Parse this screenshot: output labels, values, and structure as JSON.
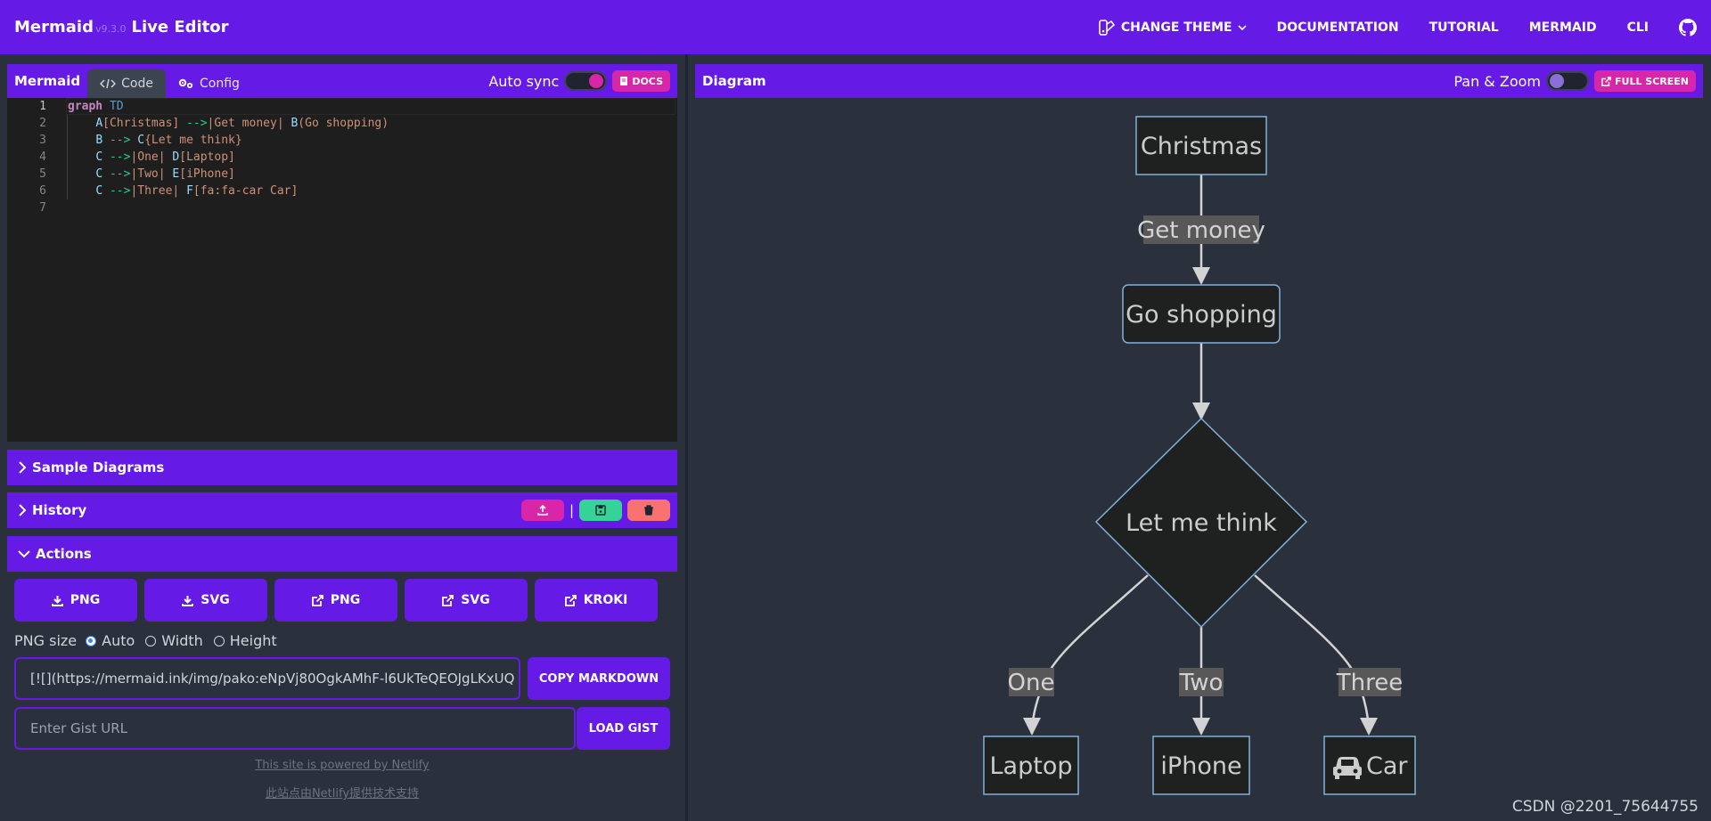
{
  "app": {
    "brand": "Mermaid",
    "version": "v9.3.0",
    "title": "Live Editor"
  },
  "nav": {
    "change_theme": "CHANGE THEME",
    "documentation": "DOCUMENTATION",
    "tutorial": "TUTORIAL",
    "mermaid": "MERMAID",
    "cli": "CLI"
  },
  "editor": {
    "title": "Mermaid",
    "tab_code": "Code",
    "tab_config": "Config",
    "auto_sync_label": "Auto sync",
    "auto_sync_on": true,
    "docs_button": "DOCS",
    "line_numbers": [
      "1",
      "2",
      "3",
      "4",
      "5",
      "6",
      "7"
    ],
    "lines": [
      "graph TD",
      "    A[Christmas] -->|Get money| B(Go shopping)",
      "    B --> C{Let me think}",
      "    C -->|One| D[Laptop]",
      "    C -->|Two| E[iPhone]",
      "    C -->|Three| F[fa:fa-car Car]",
      ""
    ]
  },
  "sections": {
    "sample_diagrams": "Sample Diagrams",
    "history": "History",
    "actions": "Actions"
  },
  "actions": {
    "buttons": [
      "PNG",
      "SVG",
      "PNG",
      "SVG",
      "KROKI"
    ],
    "button_icons": [
      "download-icon",
      "download-icon",
      "external-link-icon",
      "external-link-icon",
      "external-link-icon"
    ],
    "png_size_label": "PNG size",
    "size_options": [
      "Auto",
      "Width",
      "Height"
    ],
    "size_selected": "Auto",
    "markdown_value": "[![](https://mermaid.ink/img/pako:eNpVj80OgkAMhF-l6UkTeQEOJgLKxUQ",
    "copy_markdown": "COPY MARKDOWN",
    "gist_placeholder": "Enter Gist URL",
    "load_gist": "LOAD GIST",
    "powered_by": "This site is powered by Netlify",
    "powered_by_cn": "此站点由Netlify提供技术支持"
  },
  "diagram": {
    "title": "Diagram",
    "pan_zoom_label": "Pan & Zoom",
    "pan_zoom_on": false,
    "full_screen": "FULL SCREEN",
    "nodes": {
      "christmas": "Christmas",
      "go_shopping": "Go shopping",
      "let_me_think": "Let me think",
      "laptop": "Laptop",
      "iphone": "iPhone",
      "car": "Car"
    },
    "edges": {
      "get_money": "Get money",
      "one": "One",
      "two": "Two",
      "three": "Three"
    }
  },
  "watermark": "CSDN @2201_75644755",
  "colors": {
    "primary": "#661ae6",
    "secondary": "#d926a9",
    "success": "#36d399",
    "error": "#f87272",
    "background": "#2a303c",
    "node_fill": "#1f2020",
    "node_stroke": "#81b1db"
  }
}
